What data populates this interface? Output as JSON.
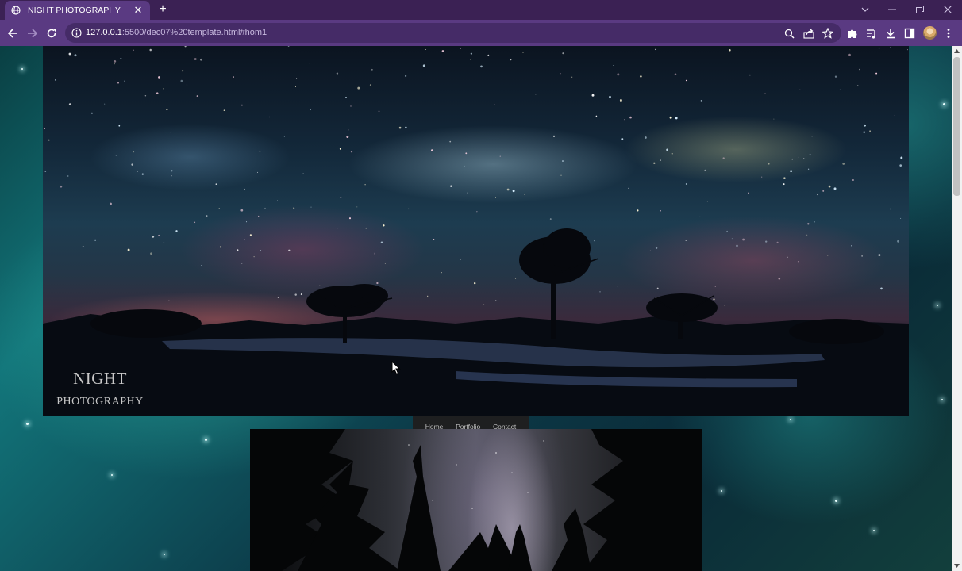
{
  "browser": {
    "tab_title": "NIGHT PHOTOGRAPHY",
    "tab_close": "✕",
    "new_tab": "+",
    "url_host": "127.0.0.1",
    "url_rest": ":5500/dec07%20template.html#hom1"
  },
  "hero": {
    "title_line1": "NIGHT",
    "title_line2": "PHOTOGRAPHY"
  },
  "nav": {
    "items": [
      "Home",
      "Portfolio",
      "Contact"
    ]
  },
  "icons": {
    "back": "arrow-left-icon",
    "forward": "arrow-right-icon",
    "reload": "reload-icon",
    "site_info": "info-icon",
    "zoom": "magnifier-icon",
    "share": "share-icon",
    "bookmark": "star-icon",
    "extensions": "puzzle-icon",
    "reading_list": "reading-list-icon",
    "downloads": "download-icon",
    "side_panel": "side-panel-icon",
    "profile": "avatar-icon",
    "menu": "kebab-menu-icon"
  },
  "colors": {
    "chrome_tabstrip": "#3b2154",
    "chrome_toolbar": "#5a3a82",
    "nav_background": "#1e1f20",
    "hero_title": "#c8c8c8"
  }
}
